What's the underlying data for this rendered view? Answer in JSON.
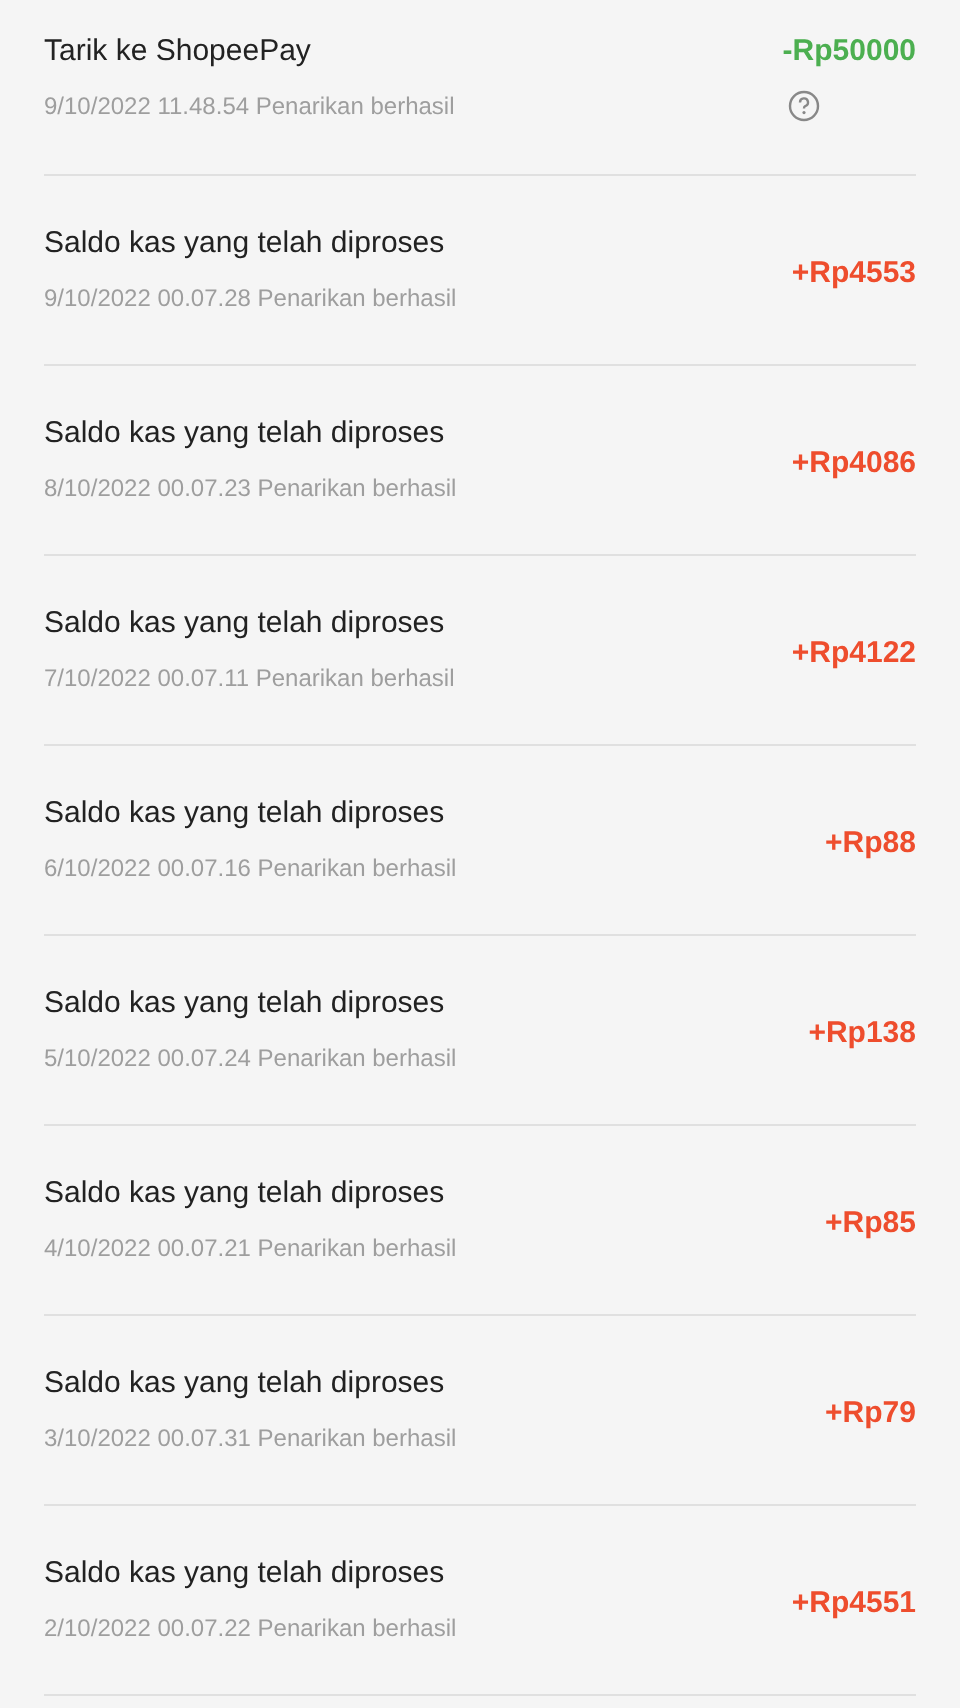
{
  "transactions": [
    {
      "kind": "withdrawal",
      "title": "Tarik ke ShopeePay",
      "time": "9/10/2022 11.48.54",
      "status": "Penarikan berhasil",
      "amount": "-Rp50000"
    },
    {
      "kind": "income",
      "title": "Saldo kas yang telah diproses",
      "time": "9/10/2022 00.07.28",
      "status": "Penarikan berhasil",
      "amount": "+Rp4553"
    },
    {
      "kind": "income",
      "title": "Saldo kas yang telah diproses",
      "time": "8/10/2022 00.07.23",
      "status": "Penarikan berhasil",
      "amount": "+Rp4086"
    },
    {
      "kind": "income",
      "title": "Saldo kas yang telah diproses",
      "time": "7/10/2022 00.07.11",
      "status": "Penarikan berhasil",
      "amount": "+Rp4122"
    },
    {
      "kind": "income",
      "title": "Saldo kas yang telah diproses",
      "time": "6/10/2022 00.07.16",
      "status": "Penarikan berhasil",
      "amount": "+Rp88"
    },
    {
      "kind": "income",
      "title": "Saldo kas yang telah diproses",
      "time": "5/10/2022 00.07.24",
      "status": "Penarikan berhasil",
      "amount": "+Rp138"
    },
    {
      "kind": "income",
      "title": "Saldo kas yang telah diproses",
      "time": "4/10/2022 00.07.21",
      "status": "Penarikan berhasil",
      "amount": "+Rp85"
    },
    {
      "kind": "income",
      "title": "Saldo kas yang telah diproses",
      "time": "3/10/2022 00.07.31",
      "status": "Penarikan berhasil",
      "amount": "+Rp79"
    },
    {
      "kind": "income",
      "title": "Saldo kas yang telah diproses",
      "time": "2/10/2022 00.07.22",
      "status": "Penarikan berhasil",
      "amount": "+Rp4551"
    }
  ]
}
